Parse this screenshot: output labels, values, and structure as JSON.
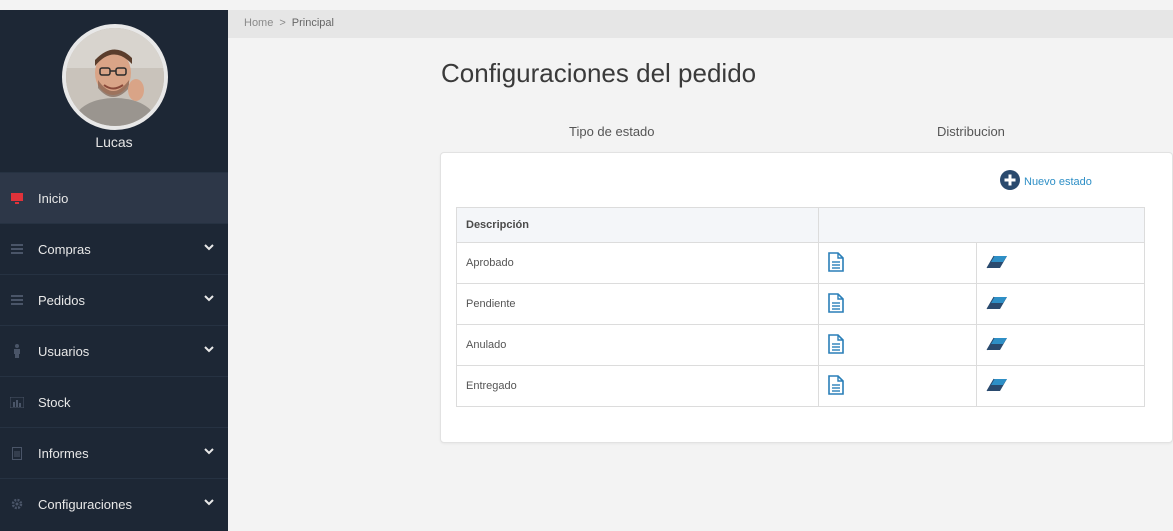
{
  "sidebar": {
    "username": "Lucas",
    "items": [
      {
        "label": "Inicio",
        "icon": "monitor-icon",
        "active": true,
        "has_submenu": false
      },
      {
        "label": "Compras",
        "icon": "list-icon",
        "active": false,
        "has_submenu": true
      },
      {
        "label": "Pedidos",
        "icon": "list-icon",
        "active": false,
        "has_submenu": true
      },
      {
        "label": "Usuarios",
        "icon": "user-icon",
        "active": false,
        "has_submenu": true
      },
      {
        "label": "Stock",
        "icon": "chart-icon",
        "active": false,
        "has_submenu": false
      },
      {
        "label": "Informes",
        "icon": "document-icon",
        "active": false,
        "has_submenu": true
      },
      {
        "label": "Configuraciones",
        "icon": "gear-icon",
        "active": false,
        "has_submenu": true
      }
    ]
  },
  "breadcrumb": {
    "home": "Home",
    "separator": ">",
    "current": "Principal"
  },
  "page": {
    "title": "Configuraciones del pedido"
  },
  "tabs": [
    {
      "label": "Tipo de estado"
    },
    {
      "label": "Distribucion"
    }
  ],
  "actions": {
    "new_state": "Nuevo estado"
  },
  "table": {
    "header": "Descripción",
    "rows": [
      {
        "description": "Aprobado"
      },
      {
        "description": "Pendiente"
      },
      {
        "description": "Anulado"
      },
      {
        "description": "Entregado"
      }
    ]
  },
  "colors": {
    "sidebar_bg": "#1d2735",
    "active_item_bg": "#2d3748",
    "active_icon": "#e0323a",
    "accent_blue": "#2e8fc6",
    "icon_blue": "#2a7fb8"
  }
}
